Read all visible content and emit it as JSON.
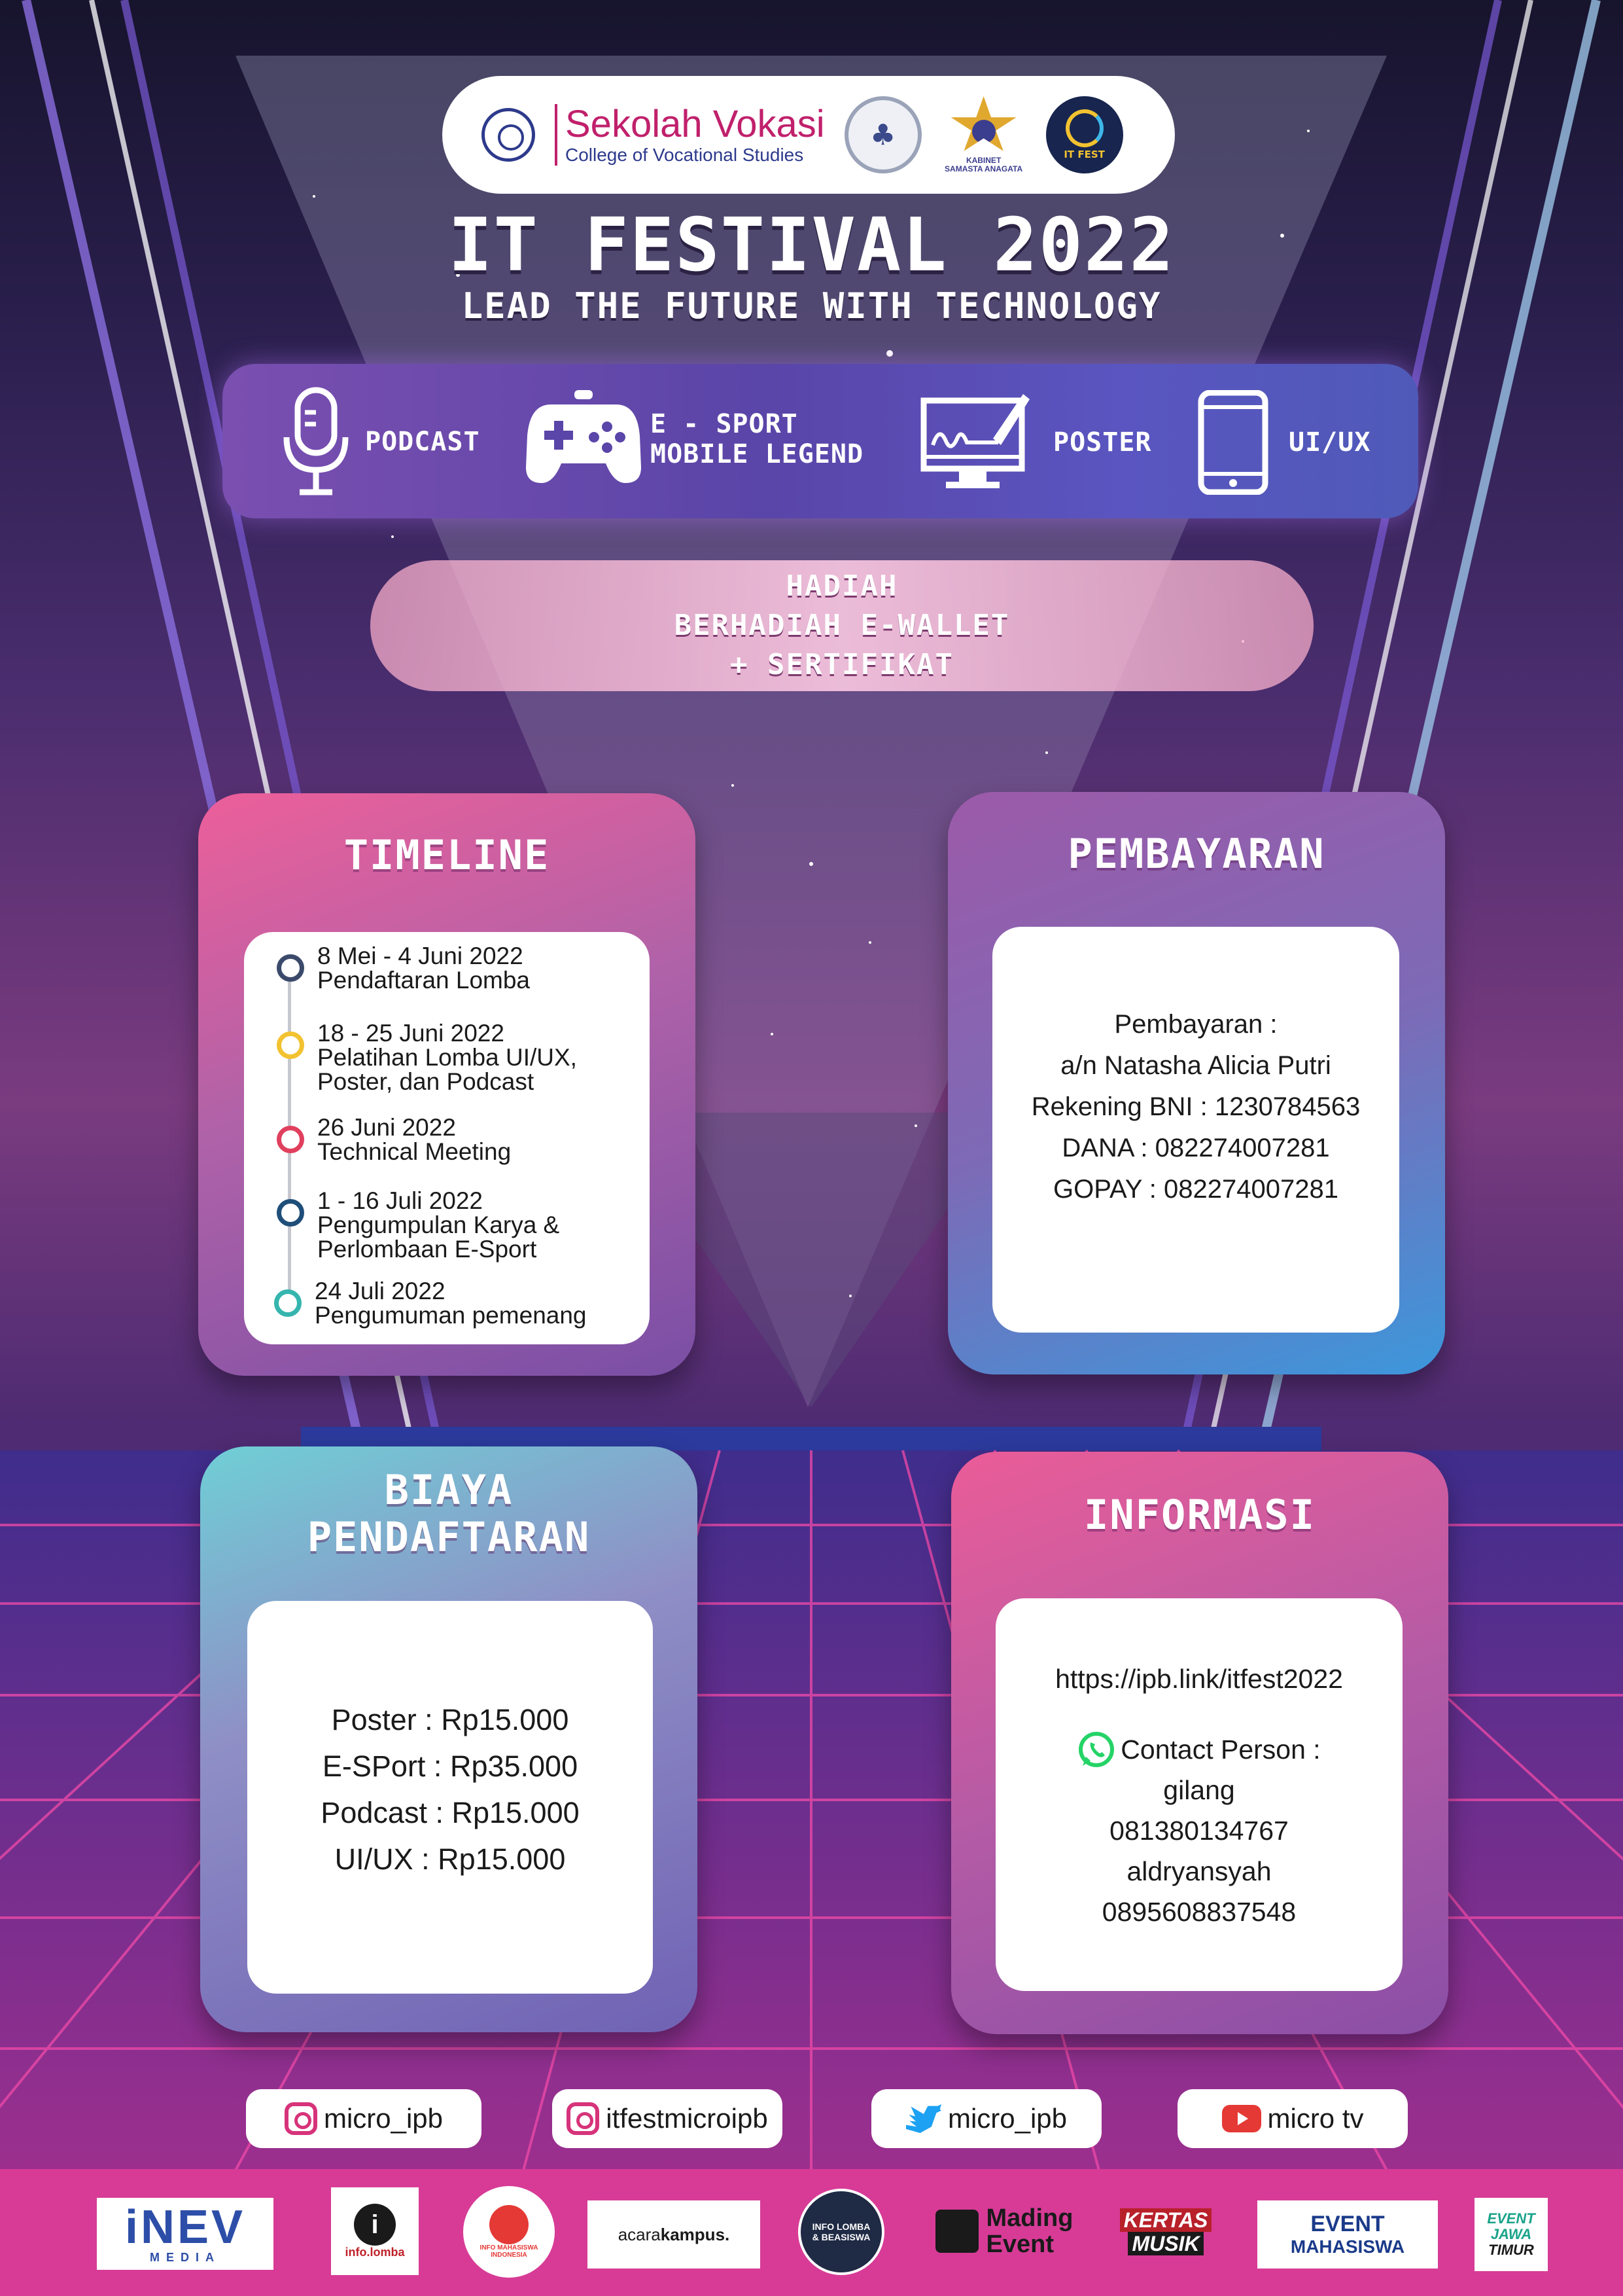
{
  "header": {
    "school_name": "Sekolah Vokasi",
    "school_subtitle": "College of Vocational Studies",
    "micro_logo_text": "♣",
    "kabinet_caption_top": "KABINET",
    "kabinet_caption_bottom": "SAMASTA ANAGATA",
    "itfest_logo_text": "IT FEST"
  },
  "title": "IT FESTIVAL 2022",
  "subtitle": "LEAD THE FUTURE WITH TECHNOLOGY",
  "competitions": [
    {
      "label": "PODCAST",
      "icon": "microphone-icon"
    },
    {
      "label_line1": "E - SPORT",
      "label_line2": "MOBILE LEGEND",
      "icon": "gamepad-icon"
    },
    {
      "label": "POSTER",
      "icon": "drawing-monitor-icon"
    },
    {
      "label": "UI/UX",
      "icon": "smartphone-icon"
    }
  ],
  "prize": {
    "line1": "HADIAH",
    "line2": "BERHADIAH E-WALLET",
    "line3": "+ SERTIFIKAT"
  },
  "timeline": {
    "title": "TIMELINE",
    "items": [
      {
        "date": "8 Mei - 4 Juni 2022",
        "desc": "Pendaftaran Lomba",
        "color": "#3b4a6b"
      },
      {
        "date": "18 - 25 Juni 2022",
        "desc1": "Pelatihan Lomba UI/UX,",
        "desc2": "Poster, dan Podcast",
        "color": "#f2c230"
      },
      {
        "date": "26 Juni 2022",
        "desc": "Technical Meeting",
        "color": "#e0405e"
      },
      {
        "date": "1 - 16 Juli 2022",
        "desc1": "Pengumpulan Karya &",
        "desc2": "Perlombaan E-Sport",
        "color": "#1f4e79"
      },
      {
        "date": "24 Juli 2022",
        "desc": "Pengumuman pemenang",
        "color": "#35b5ae"
      }
    ]
  },
  "payment": {
    "title": "PEMBAYARAN",
    "lines": [
      "Pembayaran :",
      "a/n Natasha Alicia Putri",
      "Rekening BNI : 1230784563",
      "DANA : 082274007281",
      "GOPAY : 082274007281"
    ]
  },
  "fee": {
    "title_line1": "BIAYA",
    "title_line2": "PENDAFTARAN",
    "lines": [
      "Poster : Rp15.000",
      "E-SPort : Rp35.000",
      "Podcast : Rp15.000",
      "UI/UX : Rp15.000"
    ]
  },
  "info": {
    "title": "INFORMASI",
    "link": "https://ipb.link/itfest2022",
    "contact_label": "Contact Person :",
    "contacts": [
      "gilang",
      "081380134767",
      "aldryansyah",
      "0895608837548"
    ]
  },
  "socials": [
    {
      "label": "micro_ipb",
      "icon": "instagram-icon"
    },
    {
      "label": "itfestmicroipb",
      "icon": "instagram-icon"
    },
    {
      "label": "micro_ipb",
      "icon": "twitter-icon"
    },
    {
      "label": "micro tv",
      "icon": "youtube-icon"
    }
  ],
  "sponsors": {
    "inev": "iNEV",
    "inev_sub": "MEDIA",
    "infolomba": "info.lomba",
    "info_mahasiswa": "INFO MAHASISWA INDONESIA",
    "acara_kampus_1": "acara",
    "acara_kampus_2": "kampus.",
    "info_lomba_beasiswa": "INFO LOMBA & BEASISWA",
    "mading_event_1": "Mading",
    "mading_event_2": "Event",
    "kertas_musik_1": "KERTAS",
    "kertas_musik_2": "MUSIK",
    "event_mahasiswa_1": "EVENT",
    "event_mahasiswa_2": "MAHASISWA",
    "event_jatim_1": "EVENT",
    "event_jatim_2": "JAWA",
    "event_jatim_3": "TIMUR"
  },
  "colors": {
    "accent_pink": "#ec5f9a",
    "accent_purple": "#7a4fa5",
    "footer": "#d73b96",
    "whatsapp": "#25d366"
  }
}
